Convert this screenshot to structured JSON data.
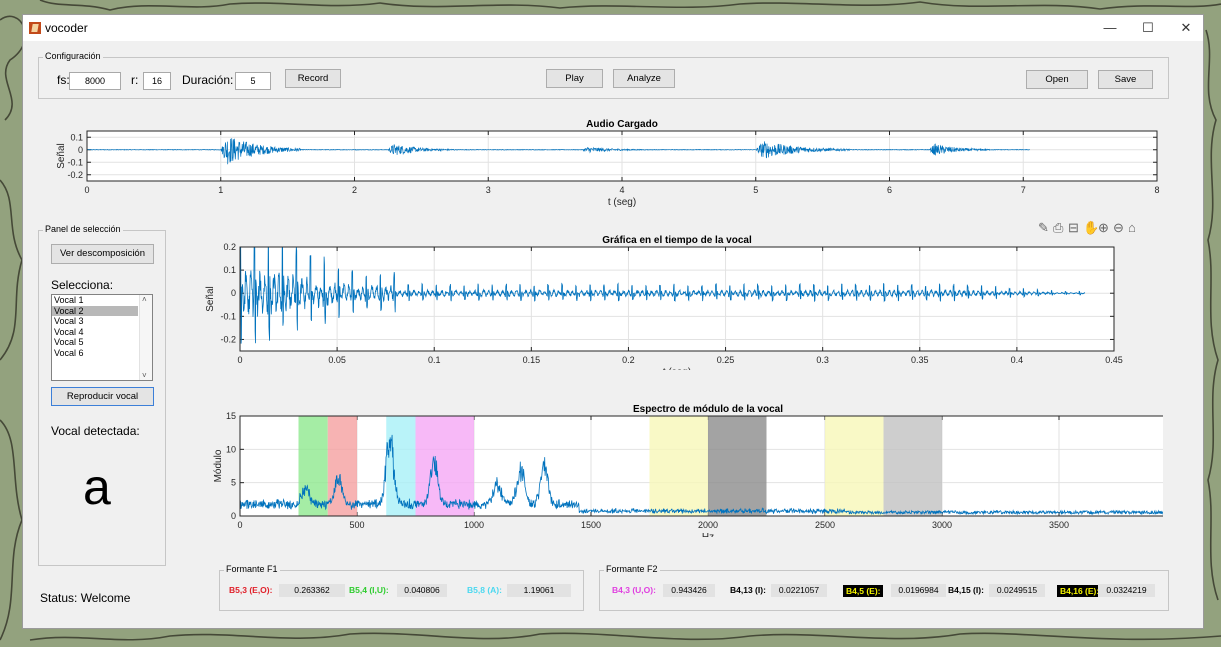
{
  "window": {
    "title": "vocoder",
    "minimize": "—",
    "maximize": "☐",
    "close": "✕"
  },
  "config": {
    "group_title": "Configuración",
    "fs_label": "fs:",
    "fs_value": "8000",
    "r_label": "r:",
    "r_value": "16",
    "dur_label": "Duración:",
    "dur_value": "5",
    "record": "Record",
    "play": "Play",
    "analyze": "Analyze",
    "open": "Open",
    "save": "Save"
  },
  "selection": {
    "group_title": "Panel de selección",
    "decompose_button": "Ver descomposición",
    "select_label": "Selecciona:",
    "items": [
      "Vocal 1",
      "Vocal 2",
      "Vocal 3",
      "Vocal 4",
      "Vocal 5",
      "Vocal 6"
    ],
    "selected_index": 1,
    "play_vocal_button": "Reproducir vocal",
    "detected_label": "Vocal detectada:",
    "detected_vowel": "a"
  },
  "status": {
    "text": "Status: Welcome"
  },
  "toolbar_icons": [
    "brush-icon",
    "print-icon",
    "datatip-icon",
    "pan-hand-icon",
    "zoom-in-icon",
    "zoom-out-icon",
    "home-icon"
  ],
  "chart_data": [
    {
      "type": "line",
      "title": "Audio Cargado",
      "xlabel": "t (seg)",
      "ylabel": "Señal",
      "xlim": [
        0,
        8
      ],
      "ylim": [
        -0.25,
        0.15
      ],
      "xticks": [
        "0",
        "1",
        "2",
        "3",
        "4",
        "5",
        "6",
        "7",
        "8"
      ],
      "yticks": [
        "0.1",
        "0",
        "-0.1",
        "-0.2"
      ],
      "bursts": [
        {
          "start": 1.0,
          "end": 1.6,
          "peak": 0.15
        },
        {
          "start": 2.25,
          "end": 2.75,
          "peak": 0.06
        },
        {
          "start": 3.7,
          "end": 4.2,
          "peak": 0.03
        },
        {
          "start": 5.0,
          "end": 5.7,
          "peak": 0.09
        },
        {
          "start": 6.3,
          "end": 6.75,
          "peak": 0.06
        }
      ],
      "line_end": 7.05
    },
    {
      "type": "line",
      "title": "Gráfica en el tiempo de la vocal",
      "xlabel": "t (seg)",
      "ylabel": "Señal",
      "xlim": [
        0,
        0.45
      ],
      "ylim": [
        -0.25,
        0.2
      ],
      "xticks": [
        "0",
        "0.05",
        "0.1",
        "0.15",
        "0.2",
        "0.25",
        "0.3",
        "0.35",
        "0.4",
        "0.45"
      ],
      "yticks": [
        "0.2",
        "0.1",
        "0",
        "-0.1",
        "-0.2"
      ],
      "line_end": 0.435,
      "initial_peak": 0.25,
      "sustained_amplitude": 0.035
    },
    {
      "type": "line",
      "title": "Espectro de módulo de la vocal",
      "xlabel": "Hz",
      "ylabel": "Módulo",
      "xlim": [
        0,
        4000
      ],
      "ylim": [
        0,
        15
      ],
      "xticks": [
        "0",
        "500",
        "1000",
        "1500",
        "2000",
        "2500",
        "3000",
        "3500",
        "4000"
      ],
      "yticks": [
        "15",
        "10",
        "5",
        "0"
      ],
      "peaks": [
        {
          "hz": 640,
          "value": 13
        },
        {
          "hz": 830,
          "value": 8
        },
        {
          "hz": 420,
          "value": 5
        },
        {
          "hz": 1200,
          "value": 6.5
        },
        {
          "hz": 1300,
          "value": 7
        },
        {
          "hz": 1100,
          "value": 4
        },
        {
          "hz": 280,
          "value": 3
        }
      ],
      "bands": [
        {
          "start": 250,
          "end": 375,
          "color": "#8ee88e"
        },
        {
          "start": 375,
          "end": 500,
          "color": "#f5a0a0"
        },
        {
          "start": 625,
          "end": 750,
          "color": "#a8f0f8"
        },
        {
          "start": 750,
          "end": 1000,
          "color": "#f5a8f5"
        },
        {
          "start": 1750,
          "end": 2000,
          "color": "#f8f8b8"
        },
        {
          "start": 2000,
          "end": 2250,
          "color": "#8c8c8c"
        },
        {
          "start": 2500,
          "end": 2750,
          "color": "#f8f8b8"
        },
        {
          "start": 2750,
          "end": 3000,
          "color": "#c2c2c2"
        }
      ]
    }
  ],
  "formant_f1": {
    "group_title": "Formante F1",
    "items": [
      {
        "label": "B5,3 (E,O):",
        "value": "0.263362",
        "color": "#e0202a",
        "bg": ""
      },
      {
        "label": "B5,4 (I,U):",
        "value": "0.040806",
        "color": "#2ecc2e",
        "bg": ""
      },
      {
        "label": "B5,8 (A):",
        "value": "1.19061",
        "color": "#4ad8f0",
        "bg": ""
      }
    ]
  },
  "formant_f2": {
    "group_title": "Formante F2",
    "items": [
      {
        "label": "B4,3 (U,O):",
        "value": "0.943426",
        "color": "#e040e0",
        "bg": ""
      },
      {
        "label": "B4,13 (I):",
        "value": "0.0221057",
        "color": "#000000",
        "bg": ""
      },
      {
        "label": "B4,5 (E):",
        "value": "0.0196984",
        "color": "#f5f500",
        "bg": "#000000"
      },
      {
        "label": "B4,15 (I):",
        "value": "0.0249515",
        "color": "#000000",
        "bg": ""
      },
      {
        "label": "B4,16 (E):",
        "value": "0.0324219",
        "color": "#f5f500",
        "bg": "#000000"
      }
    ]
  }
}
